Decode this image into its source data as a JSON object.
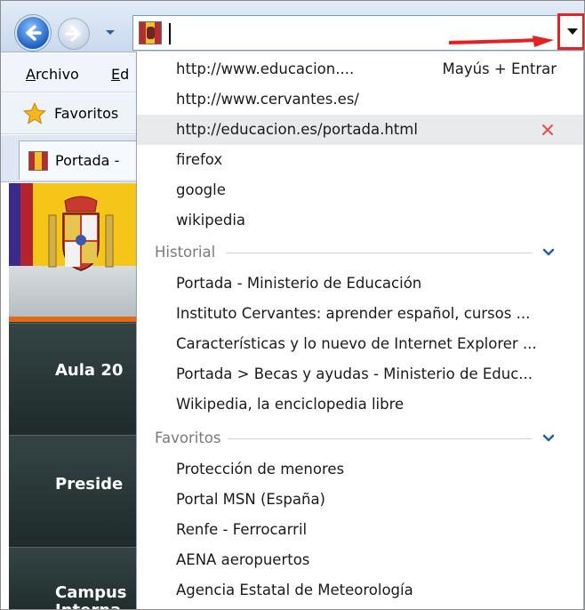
{
  "window": {
    "menu": [
      "Archivo",
      "Ed"
    ],
    "favorites_label": "Favoritos",
    "tab_label": "Portada -"
  },
  "page_peek": {
    "nav": [
      "Aula 20",
      "Preside",
      "Campus",
      "Interna"
    ]
  },
  "address_dropdown": {
    "url_items": [
      {
        "text": "http://www.educacion....",
        "hint": "Mayús + Entrar"
      },
      {
        "text": "http://www.cervantes.es/"
      },
      {
        "text": "http://educacion.es/portada.html",
        "highlighted": true
      },
      {
        "text": "firefox"
      },
      {
        "text": "google"
      },
      {
        "text": "wikipedia"
      }
    ],
    "historial": {
      "label": "Historial",
      "items": [
        "Portada - Ministerio de Educación",
        "Instituto Cervantes: aprender español, cursos ...",
        "Características y lo nuevo de Internet Explorer ...",
        "Portada > Becas y ayudas - Ministerio de Educ...",
        "Wikipedia, la enciclopedia libre"
      ]
    },
    "favoritos": {
      "label": "Favoritos",
      "items": [
        "Protección de menores",
        "Portal MSN (España)",
        "Renfe - Ferrocarril",
        "AENA aeropuertos",
        "Agencia Estatal de Meteorología"
      ]
    }
  },
  "colors": {
    "highlight_arrow": "#e52222",
    "chevron": "#1f5fa8",
    "delete_x": "#e05050"
  },
  "icons": {
    "back": "back-arrow-icon",
    "forward": "forward-arrow-icon",
    "recent": "chevron-down-icon",
    "favorites": "star-icon",
    "delete": "delete-x-icon",
    "address_dropdown": "triangle-down-icon"
  }
}
